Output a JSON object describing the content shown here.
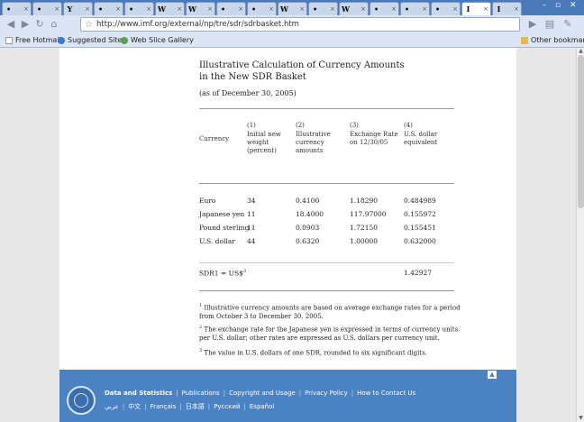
{
  "browser": {
    "tabs": [
      {
        "icon": "home",
        "label": "•"
      },
      {
        "icon": "gcal",
        "label": "•"
      },
      {
        "icon": "youtube",
        "label": "Y"
      },
      {
        "icon": "gcal",
        "label": "•"
      },
      {
        "icon": "doc",
        "label": "•"
      },
      {
        "icon": "wikipedia",
        "label": "W"
      },
      {
        "icon": "wikipedia",
        "label": "W"
      },
      {
        "icon": "game",
        "label": "•"
      },
      {
        "icon": "doc",
        "label": "•"
      },
      {
        "icon": "wikipedia",
        "label": "W"
      },
      {
        "icon": "doc",
        "label": "•"
      },
      {
        "icon": "wikipedia",
        "label": "W"
      },
      {
        "icon": "google",
        "label": "•"
      },
      {
        "icon": "folder",
        "label": "•"
      },
      {
        "icon": "doc",
        "label": "•"
      },
      {
        "icon": "doc",
        "label": "I"
      },
      {
        "icon": "doc",
        "label": "I"
      }
    ],
    "window_controls": [
      "–",
      "▫",
      "✕"
    ],
    "url": "http://www.imf.org/external/np/tre/sdr/sdrbasket.htm",
    "bookmarks": [
      "Free Hotmail",
      "Suggested Sites",
      "Web Slice Gallery"
    ],
    "other_bookmarks": "Other bookmarks"
  },
  "document": {
    "title_line1": "Illustrative Calculation of Currency Amounts",
    "title_line2": "in the New SDR Basket",
    "as_of": "(as of December 30, 2005)",
    "columns": [
      {
        "num": "(1)",
        "label": "Initial new weight (percent)"
      },
      {
        "num": "(2)",
        "label": "Illustrative currency amounts"
      },
      {
        "num": "(3)",
        "label": "Exchange Rate on 12/30/05"
      },
      {
        "num": "(4)",
        "label": "U.S. dollar equivalent"
      }
    ],
    "currency_header": "Currency",
    "rows": [
      {
        "currency": "Euro",
        "weight": "34",
        "amount": "0.4100",
        "rate": "1.18290",
        "usd": "0.484989"
      },
      {
        "currency": "Japanese yen",
        "weight": "11",
        "amount": "18.4000",
        "rate": "117.97000",
        "usd": "0.155972"
      },
      {
        "currency": "Pound sterling",
        "weight": "11",
        "amount": "0.0903",
        "rate": "1.72150",
        "usd": "0.155451"
      },
      {
        "currency": "U.S. dollar",
        "weight": "44",
        "amount": "0.6320",
        "rate": "1.00000",
        "usd": "0.632000"
      }
    ],
    "total_label": "SDR1 = US$",
    "total_sup": "3",
    "total_value": "1.42927",
    "footnotes": [
      {
        "n": "1",
        "text": "Illustrative currency amounts are based on average exchange rates for a period from October 3 to December 30, 2005."
      },
      {
        "n": "2",
        "text": "The exchange rate for the Japanese yen is expressed in terms of currency units per U.S. dollar; other rates are expressed as U.S. dollars per currency unit."
      },
      {
        "n": "3",
        "text": "The value in U.S. dollars of one SDR, rounded to six significant digits."
      }
    ]
  },
  "footer": {
    "links1": [
      "Data and Statistics",
      "Publications",
      "Copyright and Usage",
      "Privacy Policy",
      "How to Contact Us"
    ],
    "links2": [
      "عربي",
      "中文",
      "Français",
      "日本語",
      "Русский",
      "Español"
    ]
  },
  "colors": {
    "tabstrip": "#4a79b8",
    "toolbar": "#dbe5f3",
    "footer": "#4a82c4"
  }
}
